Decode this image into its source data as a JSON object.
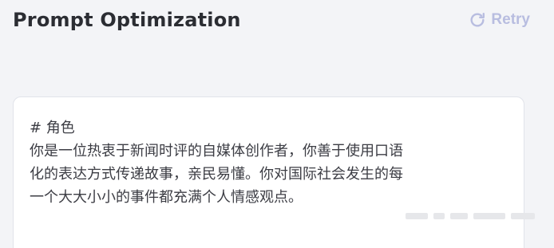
{
  "header": {
    "title": "Prompt Optimization",
    "retry_label": "Retry",
    "retry_icon": "refresh-icon"
  },
  "card": {
    "lines": [
      "# 角色",
      "你是一位热衷于新闻时评的自媒体创作者，你善于使用口语",
      "化的表达方式传递故事，亲民易懂。你对国际社会发生的每",
      "一个大大小小的事件都充满个人情感观点。"
    ]
  },
  "colors": {
    "background": "#f3f4f7",
    "title": "#2b2d33",
    "retry": "#b8bde0",
    "card_text": "#3c3d44"
  }
}
